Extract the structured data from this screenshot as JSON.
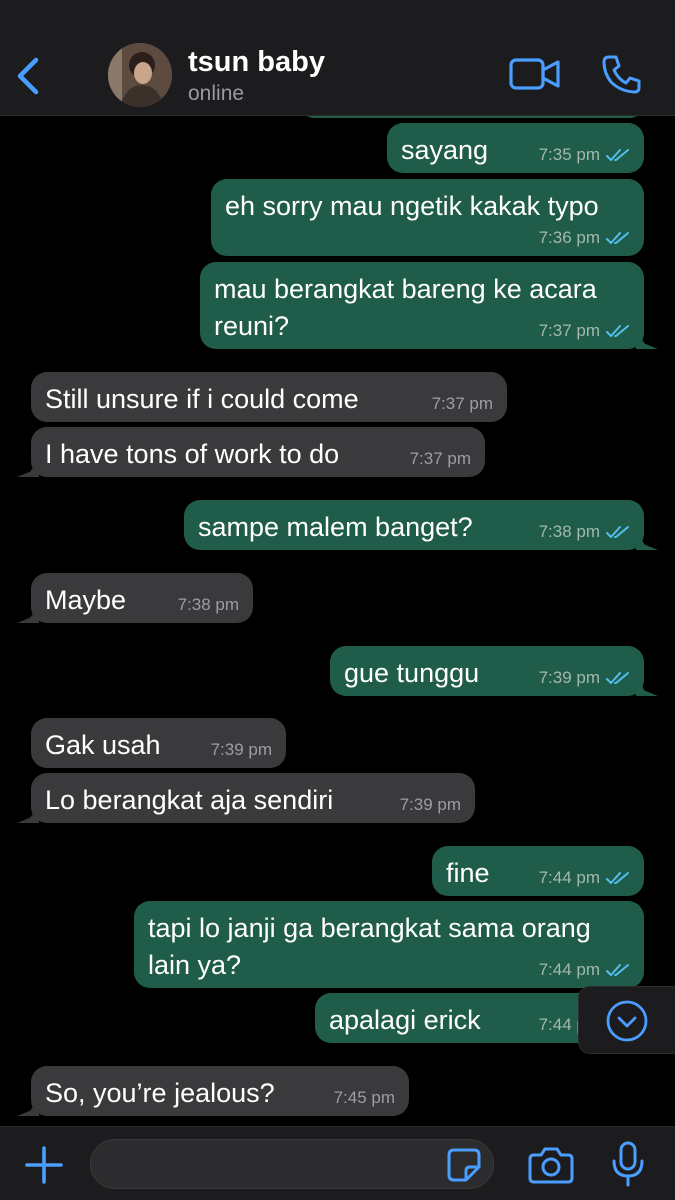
{
  "colors": {
    "accent": "#4a9eff",
    "outgoing_bubble": "#1f5c4a",
    "incoming_bubble": "#3a3a3c",
    "read_ticks": "#53bdeb"
  },
  "header": {
    "contact_name": "tsun baby",
    "status": "online",
    "icons": [
      "back-chevron-icon",
      "video-camera-icon",
      "phone-icon"
    ]
  },
  "messages": [
    {
      "dir": "out",
      "text": "sayang",
      "time": "7:35 pm",
      "read": true
    },
    {
      "dir": "out",
      "text": "eh sorry mau ngetik kakak typo",
      "time": "7:36 pm",
      "read": true
    },
    {
      "dir": "out",
      "text": "mau berangkat bareng ke acara\nreuni?",
      "time": "7:37 pm",
      "read": true
    },
    {
      "dir": "in",
      "text": "Still unsure if i could come",
      "time": "7:37 pm"
    },
    {
      "dir": "in",
      "text": "I have tons of work to do",
      "time": "7:37 pm"
    },
    {
      "dir": "out",
      "text": "sampe malem banget?",
      "time": "7:38 pm",
      "read": true
    },
    {
      "dir": "in",
      "text": "Maybe",
      "time": "7:38 pm"
    },
    {
      "dir": "out",
      "text": "gue tunggu",
      "time": "7:39 pm",
      "read": true
    },
    {
      "dir": "in",
      "text": "Gak usah",
      "time": "7:39 pm"
    },
    {
      "dir": "in",
      "text": "Lo berangkat aja sendiri",
      "time": "7:39 pm"
    },
    {
      "dir": "out",
      "text": "fine",
      "time": "7:44 pm",
      "read": true
    },
    {
      "dir": "out",
      "text": "tapi lo janji ga berangkat sama orang\nlain ya?",
      "time": "7:44 pm",
      "read": true
    },
    {
      "dir": "out",
      "text": "apalagi erick",
      "time": "7:44 pm",
      "read": true
    },
    {
      "dir": "in",
      "text": "So, you’re jealous?",
      "time": "7:45 pm"
    }
  ],
  "footer": {
    "input_value": "",
    "icons": [
      "plus-icon",
      "sticker-icon",
      "camera-icon",
      "microphone-icon"
    ]
  }
}
